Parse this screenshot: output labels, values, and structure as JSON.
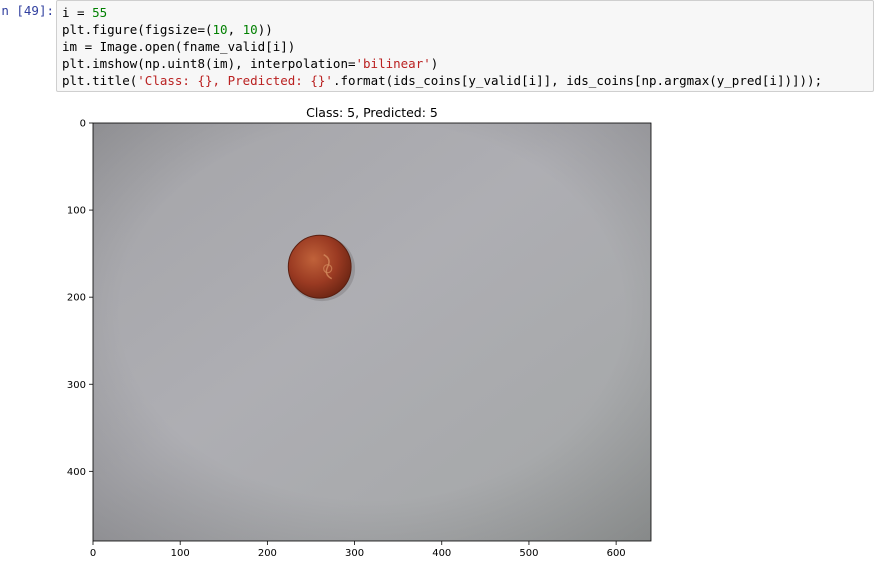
{
  "cell": {
    "prompt": "n [49]:",
    "lines": [
      [
        {
          "t": "i = ",
          "c": "op"
        },
        {
          "t": "55",
          "c": "num"
        }
      ],
      [
        {
          "t": "plt.figure(figsize=(",
          "c": "op"
        },
        {
          "t": "10",
          "c": "num"
        },
        {
          "t": ", ",
          "c": "op"
        },
        {
          "t": "10",
          "c": "num"
        },
        {
          "t": "))",
          "c": "op"
        }
      ],
      [
        {
          "t": "im = Image.open(fname_valid[i])",
          "c": "op"
        }
      ],
      [
        {
          "t": "plt.imshow(np.uint8(im), interpolation=",
          "c": "op"
        },
        {
          "t": "'bilinear'",
          "c": "str"
        },
        {
          "t": ")",
          "c": "op"
        }
      ],
      [
        {
          "t": "plt.title(",
          "c": "op"
        },
        {
          "t": "'Class: {}, Predicted: {}'",
          "c": "str"
        },
        {
          "t": ".format(ids_coins[y_valid[i]], ids_coins[np.argmax(y_pred[i])]));",
          "c": "op"
        }
      ]
    ]
  },
  "plot": {
    "title": "Class: 5, Predicted: 5",
    "xticks": [
      "0",
      "100",
      "200",
      "300",
      "400",
      "500",
      "600"
    ],
    "yticks": [
      "0",
      "100",
      "200",
      "300",
      "400"
    ],
    "xlim": [
      0,
      640
    ],
    "ylim": [
      480,
      0
    ],
    "image_content": "coin",
    "colors": {
      "background": "#a9a9ad",
      "coin": "#9a3a22"
    }
  }
}
